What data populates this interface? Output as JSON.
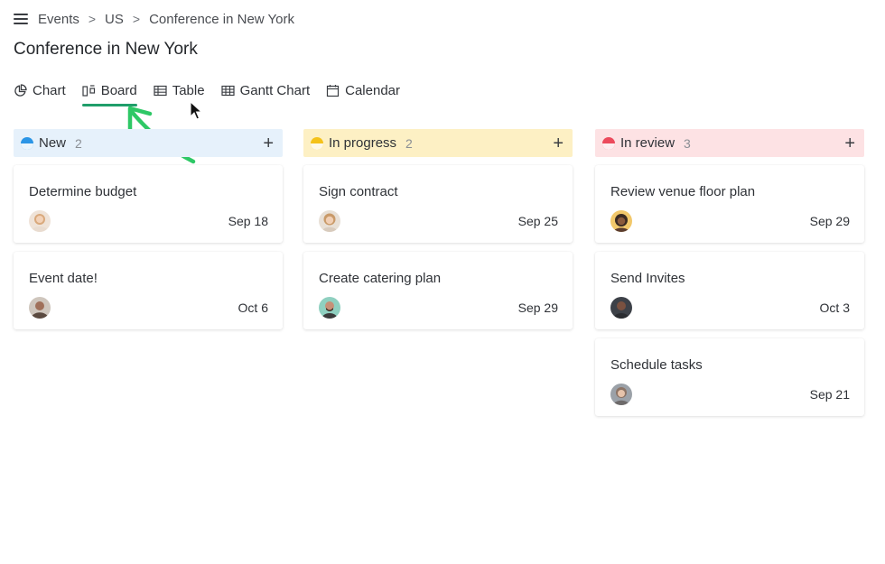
{
  "breadcrumb": {
    "items": [
      "Events",
      "US"
    ],
    "current": "Conference in New York",
    "separator": ">"
  },
  "page": {
    "title": "Conference in New York"
  },
  "tabs": [
    {
      "label": "Chart",
      "icon": "pie-chart-icon"
    },
    {
      "label": "Board",
      "icon": "board-icon",
      "active": true
    },
    {
      "label": "Table",
      "icon": "table-icon"
    },
    {
      "label": "Gantt Chart",
      "icon": "gantt-icon"
    },
    {
      "label": "Calendar",
      "icon": "calendar-icon"
    }
  ],
  "columns": [
    {
      "title": "New",
      "count": "2",
      "color": "#e6f1fb",
      "dot_color": "#2b95e6",
      "add_label": "+",
      "cards": [
        {
          "title": "Determine budget",
          "date": "Sep 18"
        },
        {
          "title": "Event date!",
          "date": "Oct 6"
        }
      ]
    },
    {
      "title": "In progress",
      "count": "2",
      "color": "#fdf0c4",
      "dot_color": "#f4c21b",
      "add_label": "+",
      "cards": [
        {
          "title": "Sign contract",
          "date": "Sep 25"
        },
        {
          "title": "Create catering plan",
          "date": "Sep 29"
        }
      ]
    },
    {
      "title": "In review",
      "count": "3",
      "color": "#fde2e4",
      "dot_color": "#ec4a5c",
      "add_label": "+",
      "cards": [
        {
          "title": "Review venue floor plan",
          "date": "Sep 29"
        },
        {
          "title": "Send Invites",
          "date": "Oct 3"
        },
        {
          "title": "Schedule tasks",
          "date": "Sep 21"
        }
      ]
    }
  ],
  "colors": {
    "active_tab_underline": "#1f9e6a",
    "annotation_arrow": "#2ec866"
  }
}
